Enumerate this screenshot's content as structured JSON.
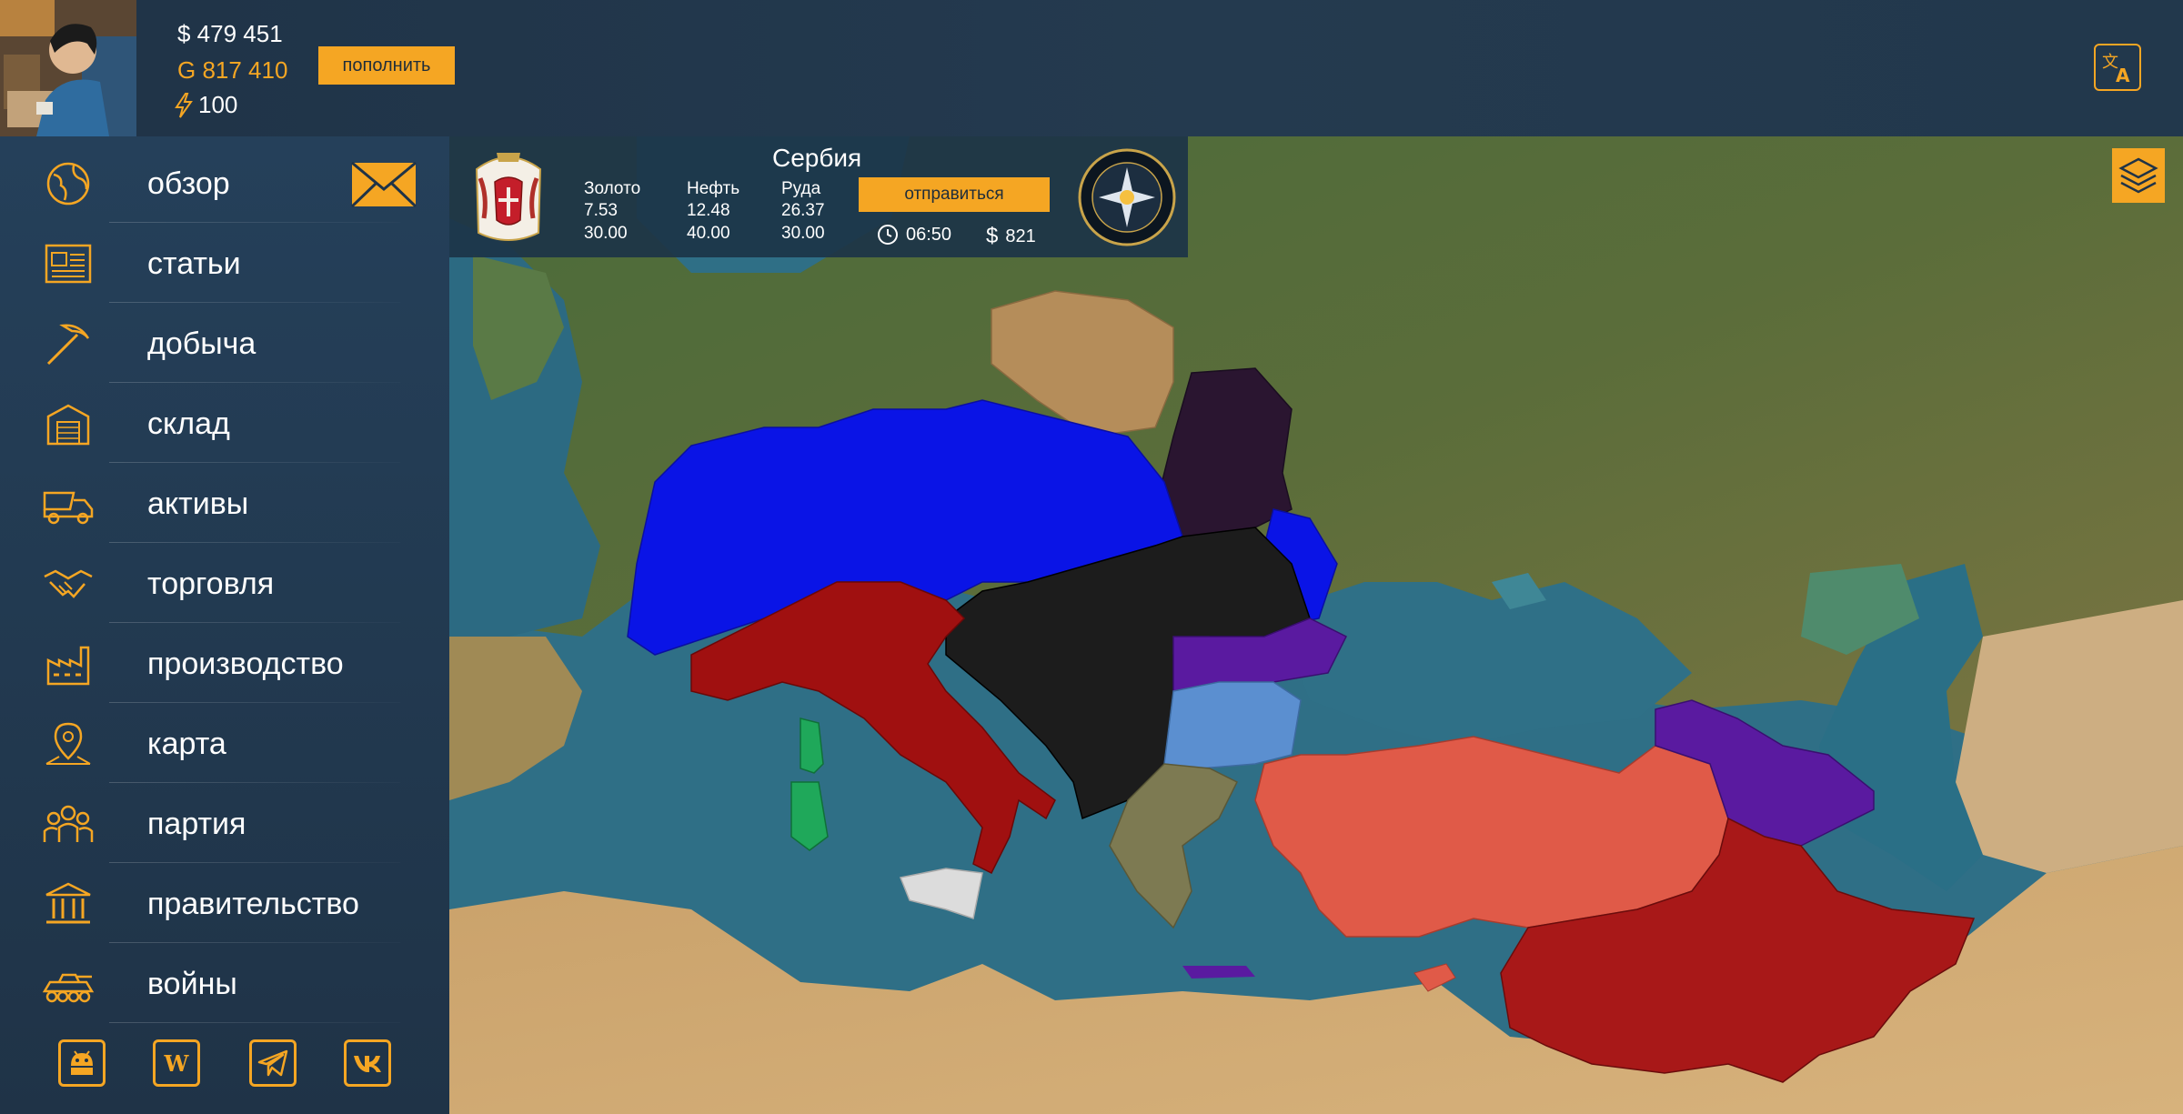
{
  "player": {
    "money": "$ 479 451",
    "gold": "G 817 410",
    "energy": "100",
    "topup_label": "пополнить"
  },
  "icons": {
    "language": "translate-icon",
    "layers": "layers-icon",
    "mail": "envelope-icon"
  },
  "colors": {
    "accent": "#f5a623",
    "panel": "#1f3347",
    "blue_bloc": "#0a14e6",
    "red_bloc": "#a01010",
    "black_bloc": "#1c1c1c",
    "purple_bloc": "#5a1aa0",
    "dark_purple_bloc": "#2a1530",
    "turkey": "#e05a48",
    "syria_iraq": "#a81818",
    "bulgaria_blue": "#5b8fd0",
    "greece": "#7d7a52",
    "tan": "#b58d5a",
    "sardinia": "#1fa85a",
    "sicily": "#dcdcdc"
  },
  "sidebar": {
    "items": [
      {
        "label": "обзор",
        "icon": "globe-icon"
      },
      {
        "label": "статьи",
        "icon": "newspaper-icon"
      },
      {
        "label": "добыча",
        "icon": "pickaxe-icon"
      },
      {
        "label": "склад",
        "icon": "warehouse-icon"
      },
      {
        "label": "активы",
        "icon": "dump-truck-icon"
      },
      {
        "label": "торговля",
        "icon": "handshake-icon"
      },
      {
        "label": "производство",
        "icon": "factory-icon"
      },
      {
        "label": "карта",
        "icon": "map-pin-icon"
      },
      {
        "label": "партия",
        "icon": "people-icon"
      },
      {
        "label": "правительство",
        "icon": "government-building-icon"
      },
      {
        "label": "войны",
        "icon": "armored-vehicle-icon"
      }
    ],
    "socials": [
      {
        "name": "android-icon"
      },
      {
        "name": "wikipedia-icon",
        "glyph": "W"
      },
      {
        "name": "telegram-icon"
      },
      {
        "name": "vk-icon"
      }
    ]
  },
  "country_panel": {
    "name": "Сербия",
    "resources": [
      {
        "label": "Золото",
        "value1": "7.53",
        "value2": "30.00"
      },
      {
        "label": "Нефть",
        "value1": "12.48",
        "value2": "40.00"
      },
      {
        "label": "Руда",
        "value1": "26.37",
        "value2": "30.00"
      }
    ],
    "depart_label": "отправиться",
    "time": "06:50",
    "cost_symbol": "$",
    "cost": "821",
    "coat_of_arms": "serbia-coat-of-arms-icon",
    "party_emblem": "party-emblem-icon"
  }
}
